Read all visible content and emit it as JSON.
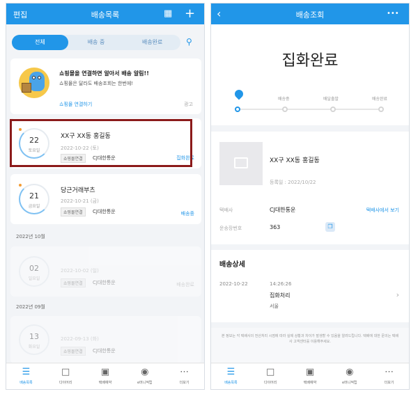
{
  "left": {
    "header": {
      "edit": "편집",
      "title": "배송목록"
    },
    "tabs": [
      "전체",
      "배송 중",
      "배송완료"
    ],
    "promo": {
      "title": "쇼핑몰을 연결하면 알아서 배송 알림!!",
      "subtitle": "쇼핑몰은 달라도 배송조회는 한번에!",
      "link": "쇼핑몰 연결하기",
      "ad": "광고"
    },
    "items": [
      {
        "day": "22",
        "weekday": "토요일",
        "title": "XX구 XX동 홍길동",
        "date": "2022-10-22 (토)",
        "chip": "쇼핑몰연결",
        "carrier": "CJ대한통운",
        "status": "집화완료"
      },
      {
        "day": "21",
        "weekday": "금요일",
        "title": "당근거래부츠",
        "date": "2022-10-21 (금)",
        "chip": "쇼핑몰연결",
        "carrier": "CJ대한통운",
        "status": "배송중"
      },
      {
        "month": "2022년 10월",
        "day": "02",
        "weekday": "일요일",
        "title": "",
        "date": "2022-10-02 (일)",
        "chip": "쇼핑몰연결",
        "carrier": "CJ대한통운",
        "status": "배송완료"
      },
      {
        "month": "2022년 09월",
        "day": "13",
        "weekday": "화요일",
        "title": "",
        "date": "2022-09-13 (화)",
        "chip": "쇼핑몰연결",
        "carrier": "CJ대한통운",
        "status": ""
      }
    ]
  },
  "right": {
    "header": {
      "title": "배송조회",
      "more": "•••"
    },
    "status": "집화완료",
    "steps": [
      "배송중",
      "배달출발",
      "배송완료"
    ],
    "progress": 0,
    "recipient": "XX구 XX동 홍길동",
    "registered": "등록일 : 2022/10/22",
    "carrier_label": "택배사",
    "carrier": "CJ대한통운",
    "carrier_link": "택배사에서 보기",
    "tracking_label": "운송장번호",
    "tracking": "363",
    "detail_title": "배송상세",
    "event": {
      "date": "2022-10-22",
      "time": "14:26:26",
      "status": "집화처리",
      "location": "서울"
    },
    "note": "본 정보는 각 택배사의 전산처리 시점에 따라 실제 상황과 차이가 발생할 수 있음을 알려드립니다. 택배에 대한 문의는 택배사 고객센터를 이용해주세요."
  },
  "tabbar": [
    "배송목록",
    "다이어리",
    "택배예약",
    "e머니적립",
    "더보기"
  ],
  "colors": {
    "accent": "#2196e8",
    "highlight_border": "#8b1a1a",
    "dot": "#f39c34"
  }
}
